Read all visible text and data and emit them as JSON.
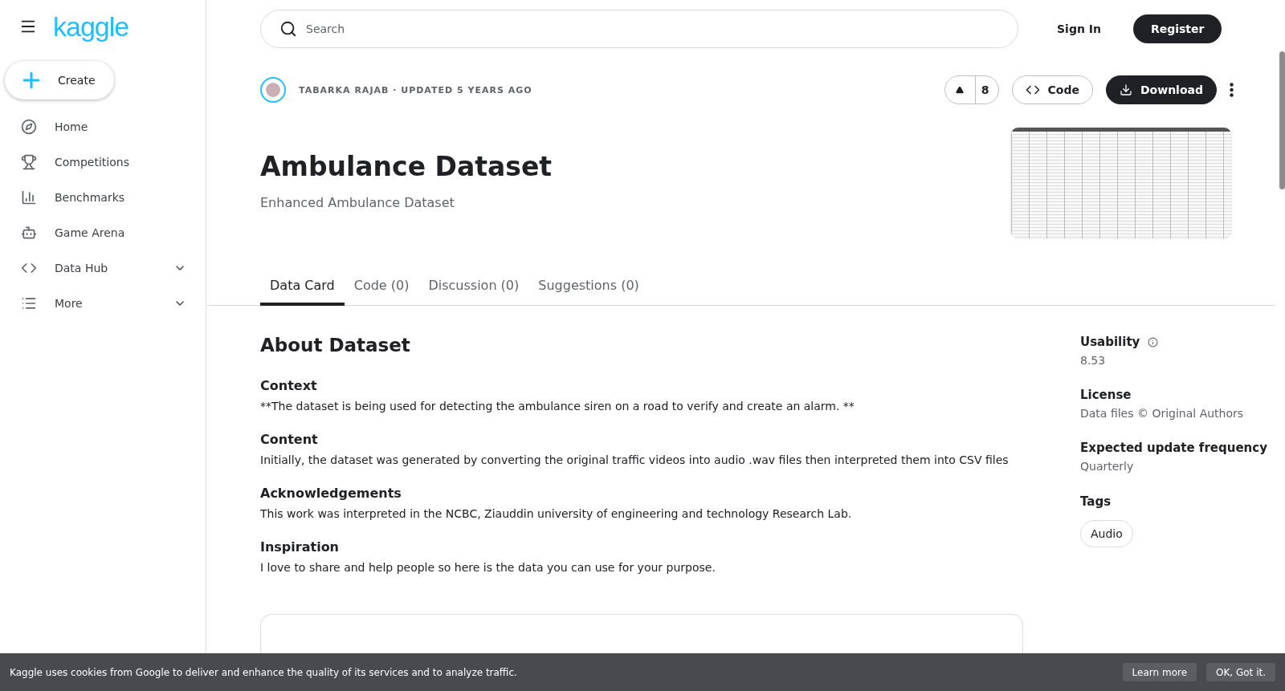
{
  "sidebar": {
    "logo": "kaggle",
    "create_label": "Create",
    "items": [
      {
        "label": "Home",
        "expandable": false
      },
      {
        "label": "Competitions",
        "expandable": false
      },
      {
        "label": "Benchmarks",
        "expandable": false
      },
      {
        "label": "Game Arena",
        "expandable": false
      },
      {
        "label": "Data Hub",
        "expandable": true
      },
      {
        "label": "More",
        "expandable": true
      }
    ]
  },
  "header": {
    "search": {
      "placeholder": "Search"
    },
    "sign_in": "Sign In",
    "register": "Register"
  },
  "dataset": {
    "byline": "TABARKA RAJAB · UPDATED 5 YEARS AGO",
    "upvotes": "8",
    "code_button": "Code",
    "download_button": "Download",
    "title": "Ambulance Dataset",
    "subtitle": "Enhanced Ambulance Dataset"
  },
  "tabs": [
    {
      "label": "Data Card",
      "selected": true
    },
    {
      "label": "Code (0)",
      "selected": false
    },
    {
      "label": "Discussion (0)",
      "selected": false
    },
    {
      "label": "Suggestions (0)",
      "selected": false
    }
  ],
  "about": {
    "heading": "About Dataset",
    "sections": [
      {
        "heading": "Context",
        "text": "**The dataset is being used for detecting the ambulance siren on a road to verify and create an alarm. **"
      },
      {
        "heading": "Content",
        "text": "Initially, the dataset was generated by converting the original traffic videos into audio .wav files then interpreted them into CSV files"
      },
      {
        "heading": "Acknowledgements",
        "text": "This work was interpreted in the NCBC, Ziauddin university of engineering and technology Research Lab."
      },
      {
        "heading": "Inspiration",
        "text": "I love to share and help people so here is the data you can use for your purpose."
      }
    ]
  },
  "meta": [
    {
      "label": "Usability",
      "value": "8.53",
      "info": true
    },
    {
      "label": "License",
      "value": "Data files © Original Authors",
      "info": false
    },
    {
      "label": "Expected update frequency",
      "value": "Quarterly",
      "info": false
    }
  ],
  "tags": {
    "heading": "Tags",
    "items": [
      "Audio"
    ]
  },
  "cookie_banner": {
    "text": "Kaggle uses cookies from Google to deliver and enhance the quality of its services and to analyze traffic.",
    "learn_more": "Learn more",
    "accept": "OK, Got it."
  }
}
